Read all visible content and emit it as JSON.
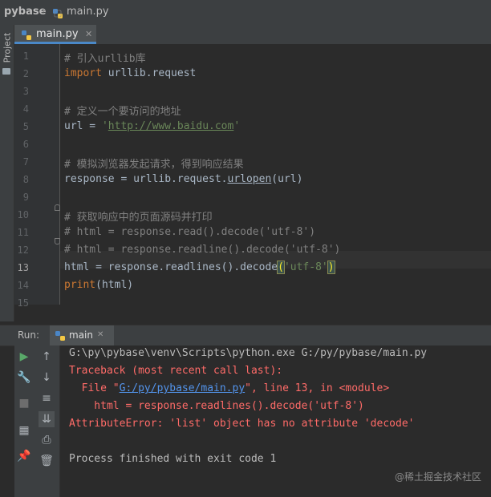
{
  "breadcrumb": {
    "project": "pybase",
    "file": "main.py"
  },
  "side_tool": {
    "project_label": "Project"
  },
  "editor": {
    "tab_label": "main.py",
    "lines": [
      {
        "num": "1",
        "parts": [
          {
            "c": "cm",
            "t": "# 引入urllib库"
          }
        ]
      },
      {
        "num": "2",
        "parts": [
          {
            "c": "kw",
            "t": "import"
          },
          {
            "c": "",
            "t": " urllib.request"
          }
        ]
      },
      {
        "num": "3",
        "parts": []
      },
      {
        "num": "4",
        "parts": [
          {
            "c": "cm",
            "t": "# 定义一个要访问的地址"
          }
        ]
      },
      {
        "num": "5",
        "parts": [
          {
            "c": "",
            "t": "url = "
          },
          {
            "c": "st",
            "t": "'"
          },
          {
            "c": "st url",
            "t": "http://www.baidu.com"
          },
          {
            "c": "st",
            "t": "'"
          }
        ]
      },
      {
        "num": "6",
        "parts": []
      },
      {
        "num": "7",
        "parts": [
          {
            "c": "cm",
            "t": "# 模拟浏览器发起请求，得到响应结果"
          }
        ]
      },
      {
        "num": "8",
        "parts": [
          {
            "c": "",
            "t": "response = urllib.request."
          },
          {
            "c": "url",
            "t": "urlopen"
          },
          {
            "c": "",
            "t": "(url)"
          }
        ]
      },
      {
        "num": "9",
        "parts": []
      },
      {
        "num": "10",
        "parts": [
          {
            "c": "cm",
            "t": "# 获取响应中的页面源码并打印"
          }
        ]
      },
      {
        "num": "11",
        "parts": [
          {
            "c": "cm",
            "t": "# html = response.read().decode('utf-8')"
          }
        ]
      },
      {
        "num": "12",
        "parts": [
          {
            "c": "cm",
            "t": "# html = response.readline().decode('utf-8')"
          }
        ]
      },
      {
        "num": "13",
        "parts": [
          {
            "c": "",
            "t": "html = response.readlines().decode"
          },
          {
            "c": "brk",
            "t": "("
          },
          {
            "c": "st",
            "t": "'utf-8'"
          },
          {
            "c": "brk",
            "t": ")"
          }
        ]
      },
      {
        "num": "14",
        "parts": [
          {
            "c": "kw",
            "t": "print"
          },
          {
            "c": "",
            "t": "(html)"
          }
        ]
      },
      {
        "num": "15",
        "parts": []
      }
    ]
  },
  "run_panel": {
    "label": "Run:",
    "tab_label": "main",
    "output": [
      [
        {
          "c": "c-norm",
          "t": "G:\\py\\pybase\\venv\\Scripts\\python.exe G:/py/pybase/main.py"
        }
      ],
      [
        {
          "c": "c-err",
          "t": "Traceback (most recent call last):"
        }
      ],
      [
        {
          "c": "c-err",
          "t": "  File \""
        },
        {
          "c": "c-link",
          "t": "G:/py/pybase/main.py"
        },
        {
          "c": "c-err",
          "t": "\", line 13, in <module>"
        }
      ],
      [
        {
          "c": "c-err",
          "t": "    html = response.readlines().decode('utf-8')"
        }
      ],
      [
        {
          "c": "c-err",
          "t": "AttributeError: 'list' object has no attribute 'decode'"
        }
      ],
      [],
      [
        {
          "c": "c-norm",
          "t": "Process finished with exit code 1"
        }
      ]
    ]
  },
  "watermark": "@稀土掘金技术社区",
  "colors": {
    "keyword": "#cc7832",
    "comment": "#808080",
    "string": "#6a8759",
    "error": "#ff6b68",
    "link": "#5394ec"
  }
}
